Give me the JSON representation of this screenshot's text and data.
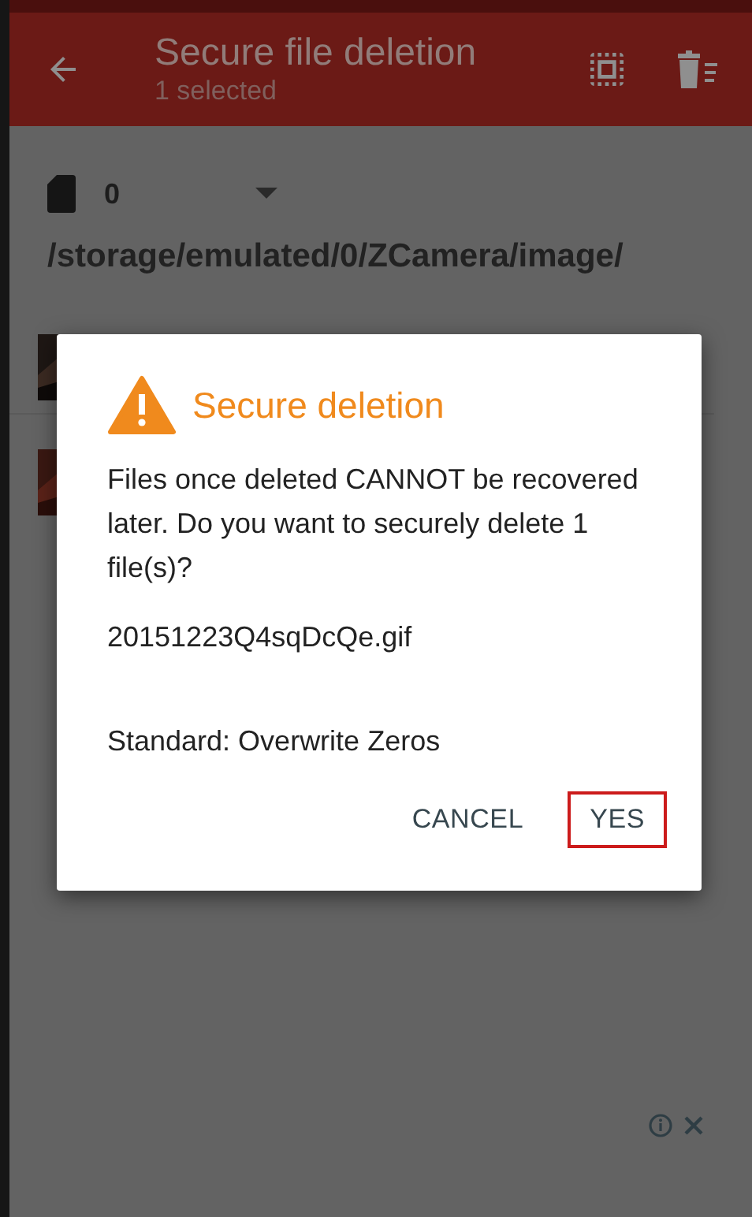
{
  "app_bar": {
    "title": "Secure file deletion",
    "subtitle": "1 selected"
  },
  "storage": {
    "label": "0"
  },
  "path": "/storage/emulated/0/ZCamera/image/",
  "dialog": {
    "title": "Secure deletion",
    "message": "Files once deleted CANNOT be recovered later. Do you want to securely delete 1 file(s)?",
    "file_name": "20151223Q4sqDcQe.gif",
    "method": "Standard: Overwrite Zeros",
    "buttons": [
      {
        "label": "CANCEL",
        "highlighted": false
      },
      {
        "label": "YES",
        "highlighted": true
      }
    ]
  }
}
